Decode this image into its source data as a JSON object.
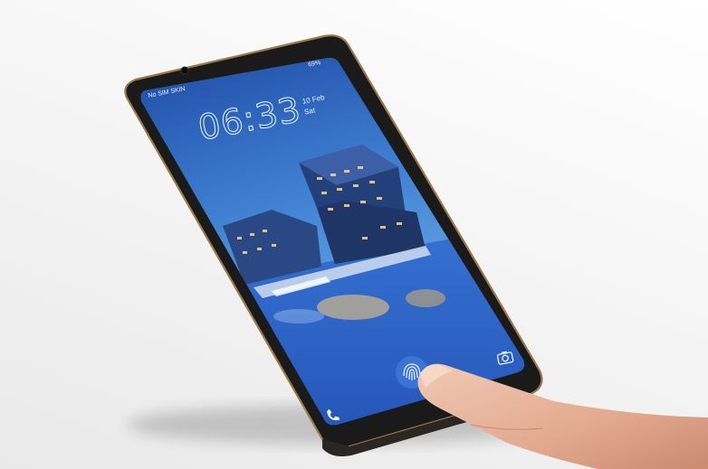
{
  "photo": {
    "subject": "smartphone-with-in-display-fingerprint-sensor",
    "background_color": "#f2f2f2",
    "phone_frame_color": "#1b1a1a",
    "phone_trim_color": "#9a7a4a"
  },
  "lock_screen": {
    "status_bar": {
      "carrier": "No SIM SKIN",
      "battery": "69%"
    },
    "clock": {
      "time": "06:33",
      "date": "10 Feb",
      "weekday": "Sat"
    },
    "wallpaper_colors": {
      "sky_top": "#1e4fa8",
      "sky_bottom": "#5a9be0",
      "water": "#2c62c8"
    },
    "icons": {
      "fingerprint": "fingerprint-icon",
      "camera": "camera-icon",
      "phone": "phone-icon"
    }
  }
}
